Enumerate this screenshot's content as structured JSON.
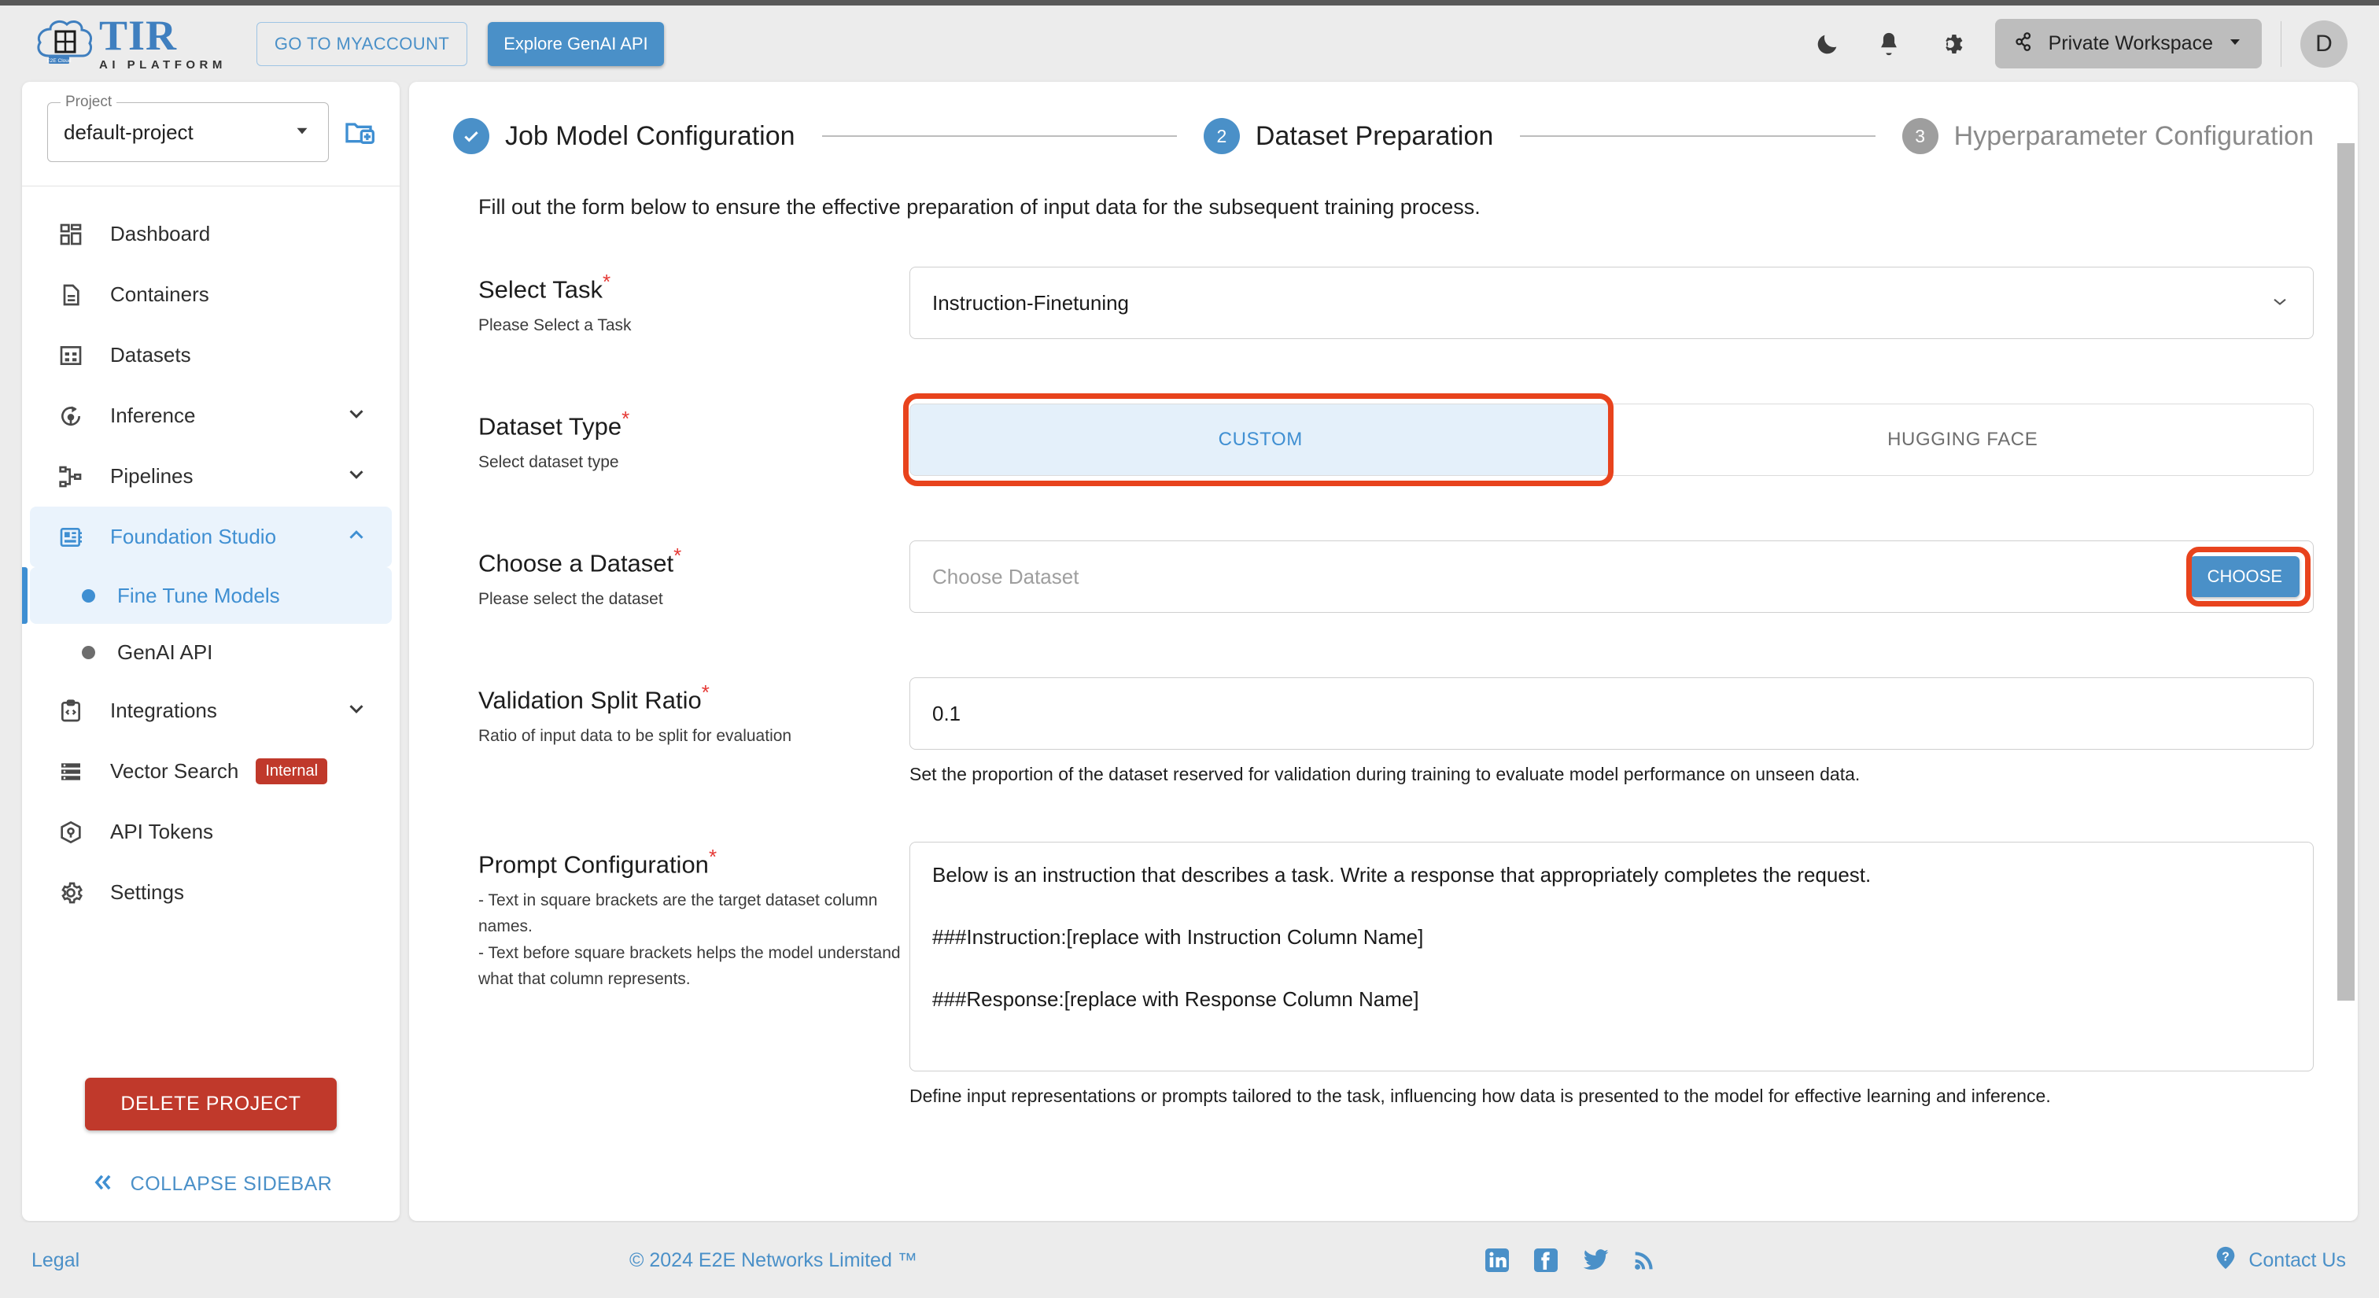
{
  "header": {
    "logo_title": "TIR",
    "logo_subtitle": "AI PLATFORM",
    "logo_badge": "E2E Cloud",
    "btn_myaccount": "GO TO MYACCOUNT",
    "btn_genai": "Explore GenAI API",
    "icons": {
      "dark_mode": "moon-icon",
      "notifications": "bell-icon",
      "settings": "gear-icon"
    },
    "workspace_label": "Private Workspace",
    "avatar_initial": "D"
  },
  "sidebar": {
    "project_legend": "Project",
    "project_value": "default-project",
    "new_project_icon": "new-folder-icon",
    "items": [
      {
        "label": "Dashboard",
        "icon": "dashboard-icon",
        "expandable": false
      },
      {
        "label": "Containers",
        "icon": "document-icon",
        "expandable": false
      },
      {
        "label": "Datasets",
        "icon": "table-icon",
        "expandable": false
      },
      {
        "label": "Inference",
        "icon": "inference-icon",
        "expandable": true
      },
      {
        "label": "Pipelines",
        "icon": "pipeline-icon",
        "expandable": true
      },
      {
        "label": "Foundation Studio",
        "icon": "foundation-studio-icon",
        "expandable": true,
        "active": true
      }
    ],
    "sub_items": [
      {
        "label": "Fine Tune Models",
        "active": true
      },
      {
        "label": "GenAI API",
        "active": false
      }
    ],
    "items_after": [
      {
        "label": "Integrations",
        "icon": "code-clipboard-icon",
        "expandable": true
      },
      {
        "label": "Vector Search",
        "icon": "list-icon",
        "expandable": false,
        "badge": "Internal"
      },
      {
        "label": "API Tokens",
        "icon": "cube-icon",
        "expandable": false
      },
      {
        "label": "Settings",
        "icon": "gear-icon",
        "expandable": false
      }
    ],
    "delete_project_label": "DELETE PROJECT",
    "collapse_label": "COLLAPSE SIDEBAR"
  },
  "stepper": {
    "step1": {
      "label": "Job Model Configuration",
      "state": "done",
      "marker": "check"
    },
    "step2": {
      "label": "Dataset Preparation",
      "state": "current",
      "marker": "2"
    },
    "step3": {
      "label": "Hyperparameter Configuration",
      "state": "todo",
      "marker": "3"
    }
  },
  "main": {
    "intro": "Fill out the form below to ensure the effective preparation of input data for the subsequent training process.",
    "select_task": {
      "label": "Select Task",
      "required_mark": "*",
      "sublabel": "Please Select a Task",
      "value": "Instruction-Finetuning"
    },
    "dataset_type": {
      "label": "Dataset Type",
      "required_mark": "*",
      "sublabel": "Select dataset type",
      "options": [
        "CUSTOM",
        "HUGGING FACE"
      ],
      "selected": "CUSTOM"
    },
    "choose_dataset": {
      "label": "Choose a Dataset",
      "required_mark": "*",
      "sublabel": "Please select the dataset",
      "placeholder": "Choose Dataset",
      "button_label": "CHOOSE"
    },
    "validation_split": {
      "label": "Validation Split Ratio",
      "required_mark": "*",
      "sublabel": "Ratio of input data to be split for evaluation",
      "value": "0.1",
      "helper": "Set the proportion of the dataset reserved for validation during training to evaluate model performance on unseen data."
    },
    "prompt_config": {
      "label": "Prompt Configuration",
      "required_mark": "*",
      "sublabel_line1": "- Text in square brackets are the target dataset column names.",
      "sublabel_line2": "- Text before square brackets helps the model understand what that column represents.",
      "line1": "Below is an instruction that describes a task. Write a response that appropriately completes the request.",
      "line2": "###Instruction:[replace with Instruction Column Name]",
      "line3": "###Response:[replace with Response Column Name]",
      "helper": "Define input representations or prompts tailored to the task, influencing how data is presented to the model for effective learning and inference."
    }
  },
  "footer": {
    "legal": "Legal",
    "copyright": "© 2024 E2E Networks Limited ™",
    "social": [
      "linkedin-icon",
      "facebook-icon",
      "twitter-icon",
      "rss-icon"
    ],
    "contact": "Contact Us"
  },
  "colors": {
    "accent": "#4a90c8",
    "danger": "#c0392b",
    "highlight": "#e8431d",
    "selected_bg": "#e4f0fa"
  }
}
